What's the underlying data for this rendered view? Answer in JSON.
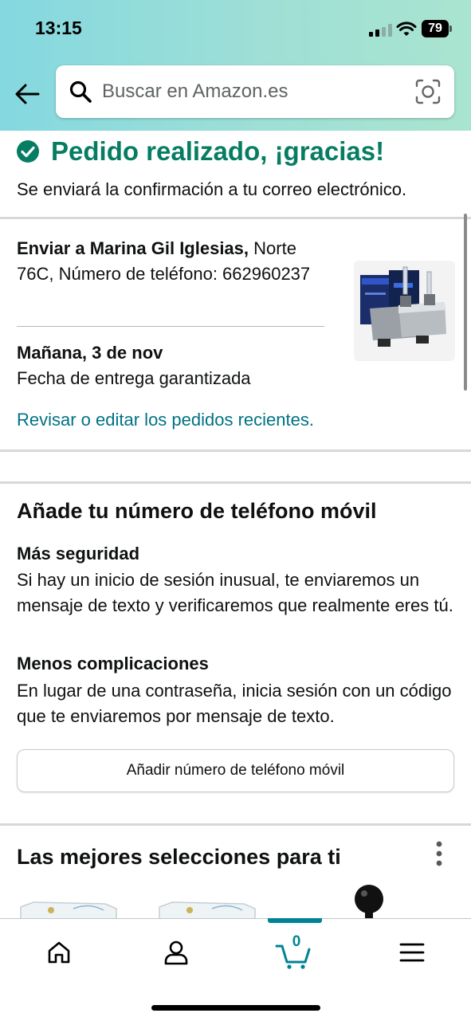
{
  "status_bar": {
    "time": "13:15",
    "battery": "79"
  },
  "search": {
    "placeholder": "Buscar en Amazon.es"
  },
  "confirmation": {
    "title": "Pedido realizado, ¡gracias!",
    "subtitle": "Se enviará la confirmación a tu correo electrónico."
  },
  "shipment": {
    "ship_to_label": "Enviar a Marina Gil Iglesias,",
    "address": " Norte 76C, Número de teléfono: 662960237",
    "delivery_date": "Mañana, 3 de nov",
    "delivery_note": "Fecha de entrega garantizada",
    "review_link": "Revisar o editar los pedidos recientes."
  },
  "add_phone": {
    "title": "Añade tu número de teléfono móvil",
    "benefit1_title": "Más seguridad",
    "benefit1_body": "Si hay un inicio de sesión inusual, te enviaremos un mensaje de texto y verificaremos que realmente eres tú.",
    "benefit2_title": "Menos complicaciones",
    "benefit2_body": "En lugar de una contraseña, inicia sesión con un código que te enviaremos por mensaje de texto.",
    "button_label": "Añadir número de teléfono móvil"
  },
  "recommendations": {
    "title": "Las mejores selecciones para ti"
  },
  "bottom_nav": {
    "items": [
      {
        "icon": "home-icon"
      },
      {
        "icon": "account-icon"
      },
      {
        "icon": "cart-icon",
        "count": "0"
      },
      {
        "icon": "menu-icon"
      }
    ]
  },
  "colors": {
    "accent": "#067d62",
    "link": "#007185",
    "cart": "#008296"
  }
}
